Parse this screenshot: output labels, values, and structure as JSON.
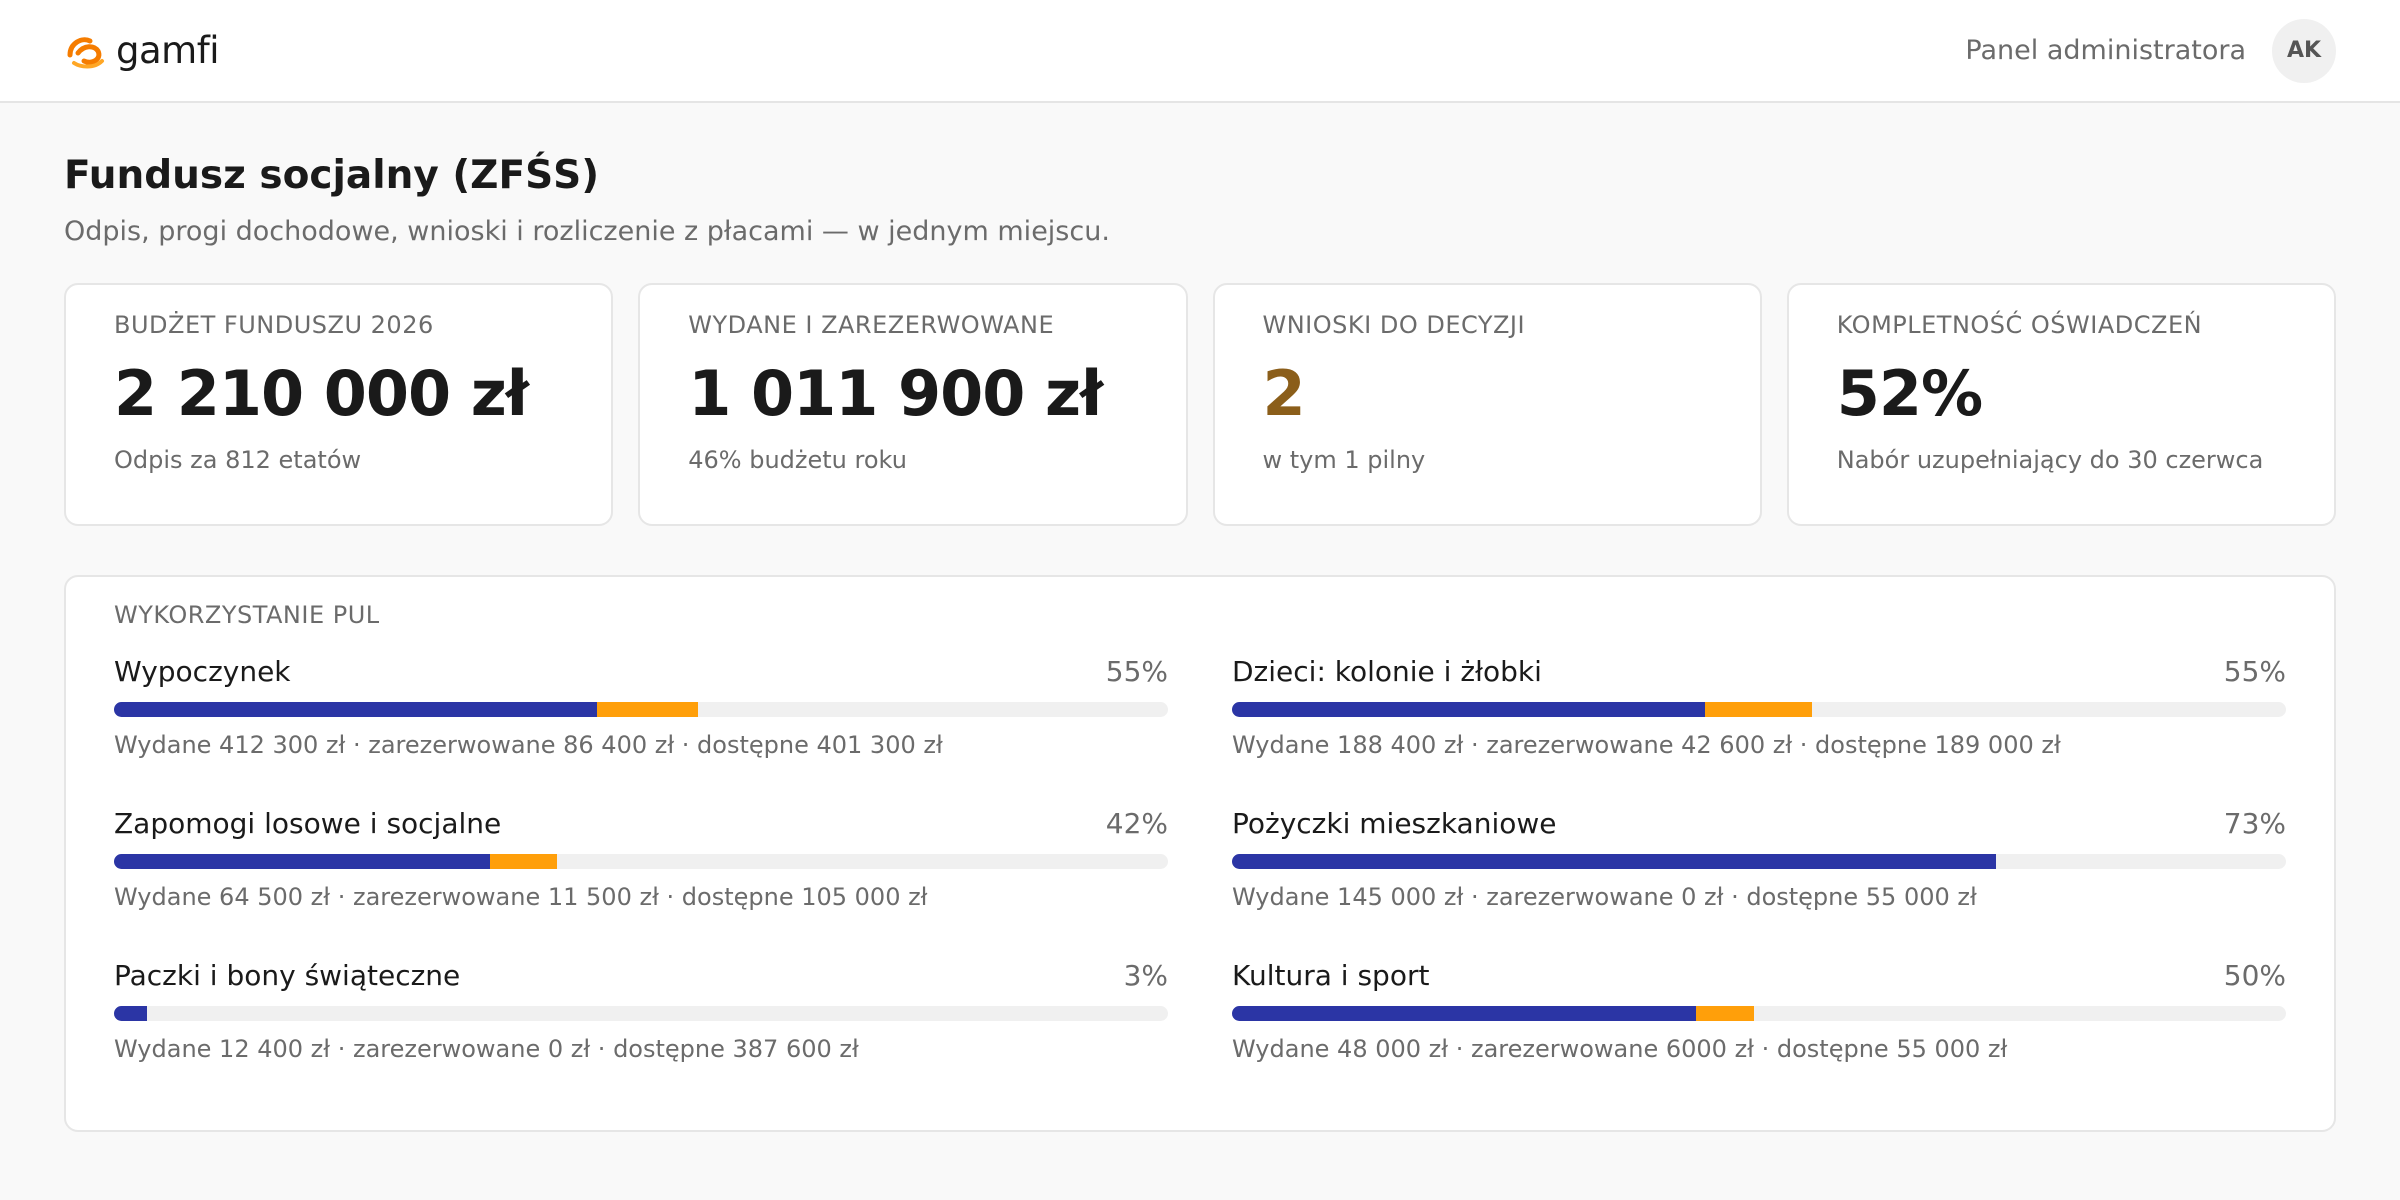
{
  "header": {
    "brand": "gamfi",
    "panel_label": "Panel administratora",
    "avatar_initials": "AK"
  },
  "page": {
    "title": "Fundusz socjalny (ZFŚS)",
    "subtitle": "Odpis, progi dochodowe, wnioski i rozliczenie z płacami — w jednym miejscu."
  },
  "kpis": [
    {
      "label": "BUDŻET FUNDUSZU 2026",
      "value": "2 210 000 zł",
      "note": "Odpis za 812 etatów"
    },
    {
      "label": "WYDANE I ZAREZERWOWANE",
      "value": "1 011 900 zł",
      "note": "46% budżetu roku"
    },
    {
      "label": "WNIOSKI DO DECYZJI",
      "value": "2",
      "note": "w tym 1 pilny"
    },
    {
      "label": "KOMPLETNOŚĆ OŚWIADCZEŃ",
      "value": "52%",
      "note": "Nabór uzupełniający do 30 czerwca"
    }
  ],
  "pools": {
    "title": "WYKORZYSTANIE PUL",
    "items": [
      {
        "name": "Wypoczynek",
        "pct": "55%",
        "spent": 412300,
        "reserved": 86400,
        "available": 401300,
        "detail": "Wydane 412 300 zł · zarezerwowane 86 400 zł · dostępne 401 300 zł"
      },
      {
        "name": "Dzieci: kolonie i żłobki",
        "pct": "55%",
        "spent": 188400,
        "reserved": 42600,
        "available": 189000,
        "detail": "Wydane 188 400 zł · zarezerwowane 42 600 zł · dostępne 189 000 zł"
      },
      {
        "name": "Zapomogi losowe i socjalne",
        "pct": "42%",
        "spent": 64500,
        "reserved": 11500,
        "available": 105000,
        "detail": "Wydane 64 500 zł · zarezerwowane 11 500 zł · dostępne 105 000 zł"
      },
      {
        "name": "Pożyczki mieszkaniowe",
        "pct": "73%",
        "spent": 145000,
        "reserved": 0,
        "available": 55000,
        "detail": "Wydane 145 000 zł · zarezerwowane 0 zł · dostępne 55 000 zł"
      },
      {
        "name": "Paczki i bony świąteczne",
        "pct": "3%",
        "spent": 12400,
        "reserved": 0,
        "available": 387600,
        "detail": "Wydane 12 400 zł · zarezerwowane 0 zł · dostępne 387 600 zł"
      },
      {
        "name": "Kultura i sport",
        "pct": "50%",
        "spent": 48000,
        "reserved": 6000,
        "available": 55000,
        "detail": "Wydane 48 000 zł · zarezerwowane 6000 zł · dostępne 55 000 zł"
      }
    ]
  },
  "colors": {
    "spent": "#2b35a5",
    "reserved": "#ff9f0a",
    "track": "#f0f0f0",
    "accent_value": "#8b5e1a",
    "brand_orange": "#f57c00"
  }
}
